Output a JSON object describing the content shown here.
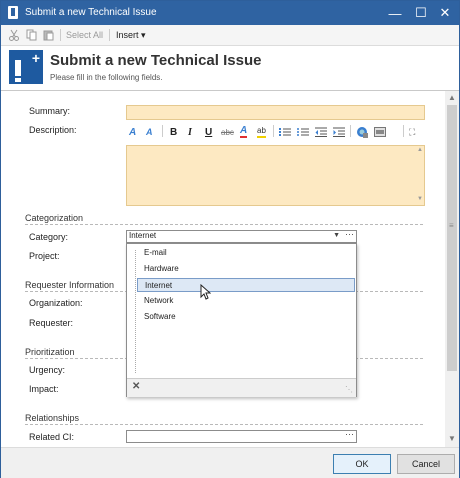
{
  "window": {
    "title": "Submit a new Technical Issue",
    "controls": [
      "minimize-icon",
      "maximize-icon",
      "close-icon"
    ]
  },
  "toolbar": {
    "cut_icon": "scissors-icon",
    "copy_icon": "copy-icon",
    "paste_icon": "paste-icon",
    "select_all_label": "Select All",
    "insert_label": "Insert ▾"
  },
  "header": {
    "title": "Submit a new Technical Issue",
    "subtitle": "Please fill in the following fields."
  },
  "form": {
    "summary_label": "Summary:",
    "summary_value": "",
    "description_label": "Description:",
    "description_value": "",
    "richtext_tools": [
      "font-grow-icon",
      "font-shrink-icon",
      "bold-icon",
      "italic-icon",
      "underline-icon",
      "strikethrough-icon",
      "font-color-icon",
      "highlight-icon",
      "numbered-list-icon",
      "bulleted-list-icon",
      "decrease-indent-icon",
      "increase-indent-icon",
      "link-icon",
      "image-icon",
      "fullscreen-icon"
    ],
    "sections": {
      "categorization": "Categorization",
      "requester": "Requester Information",
      "prioritization": "Prioritization",
      "relationships": "Relationships"
    },
    "category_label": "Category:",
    "category_value": "Internet",
    "project_label": "Project:",
    "organization_label": "Organization:",
    "requester_label": "Requester:",
    "urgency_label": "Urgency:",
    "impact_label": "Impact:",
    "related_ci_label": "Related CI:"
  },
  "dropdown": {
    "options": [
      "E-mail",
      "Hardware",
      "Internet",
      "Network",
      "Software"
    ],
    "selected": "Internet",
    "clear_icon": "clear-x-icon"
  },
  "footer": {
    "ok_label": "OK",
    "cancel_label": "Cancel"
  },
  "colors": {
    "titlebar": "#2f63a2",
    "required_field": "#fde9c2",
    "selection": "#dde8f5"
  }
}
